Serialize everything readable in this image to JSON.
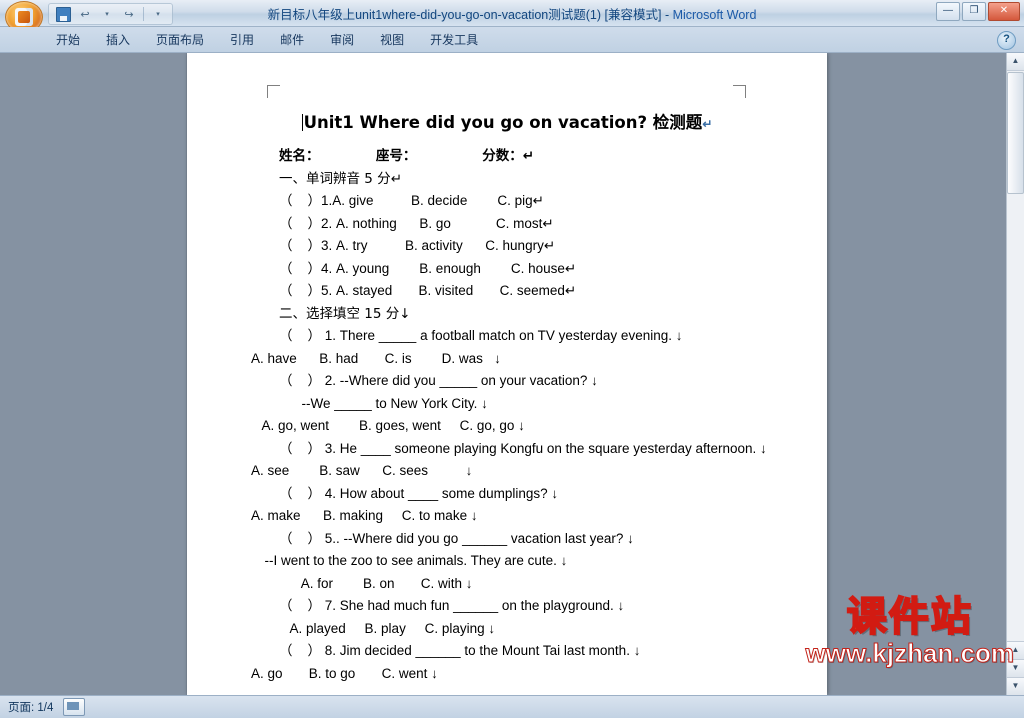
{
  "window": {
    "title_document": "新目标八年级上unit1where-did-you-go-on-vacation测试题(1) [兼容模式]",
    "title_separator": " - ",
    "app_name": "Microsoft Word",
    "minimize": "—",
    "maximize": "❐",
    "close": "✕"
  },
  "quick_access": {
    "save_tooltip": "保存",
    "undo": "↩",
    "undo_caret": "▾",
    "redo": "↪",
    "customize_caret": "▾"
  },
  "ribbon": {
    "tabs": [
      {
        "label": "开始",
        "active": false
      },
      {
        "label": "插入",
        "active": false
      },
      {
        "label": "页面布局",
        "active": false
      },
      {
        "label": "引用",
        "active": false
      },
      {
        "label": "邮件",
        "active": false
      },
      {
        "label": "审阅",
        "active": false
      },
      {
        "label": "视图",
        "active": false
      },
      {
        "label": "开发工具",
        "active": false
      }
    ],
    "help_label": "?"
  },
  "document": {
    "title": "Unit1 Where did you go on vacation?  检测题",
    "paragraph_mark": "↵",
    "lines": [
      "姓名：            座号：              分数：↵",
      "一、单词辨音 5 分↵",
      "（    ）1.A. give          B. decide        C. pig↵",
      "（    ）2. A. nothing      B. go            C. most↵",
      "（    ）3. A. try          B. activity      C. hungry↵",
      "（    ）4. A. young        B. enough        C. house↵",
      "（    ）5. A. stayed       B. visited       C. seemed↵",
      "二、选择填空 15 分↓",
      "（    ） 1. There _____ a football match on TV yesterday evening. ↓",
      "A. have      B. had       C. is        D. was   ↓",
      "（    ） 2. --Where did you _____ on your vacation? ↓",
      "      --We _____ to New York City. ↓",
      "   A. go, went        B. goes, went     C. go, go ↓",
      "（    ） 3. He ____ someone playing Kongfu on the square yesterday afternoon. ↓",
      "A. see        B. saw      C. sees          ↓",
      "（    ） 4. How about ____ some dumplings? ↓",
      "A. make      B. making     C. to make ↓",
      "（    ） 5.. --Where did you go ______ vacation last year? ↓",
      "  --I went to the zoo to see animals. They are cute. ↓",
      "      A. for        B. on       C. with ↓",
      "（    ） 7. She had much fun ______ on the playground. ↓",
      "   A. played     B. play     C. playing ↓",
      "（    ） 8. Jim decided ______ to the Mount Tai last month. ↓",
      "A. go       B. to go       C. went ↓"
    ]
  },
  "status_bar": {
    "page_label": "页面: 1/4"
  },
  "watermark": {
    "top": "课件站",
    "bottom": "www.kjzhan.com"
  },
  "scrollbar": {
    "up_arrow": "▲",
    "down_arrow": "▼",
    "prev_page": "▲",
    "next_page": "▼"
  },
  "colors": {
    "title_blue": "#12467f",
    "watermark_yellow": "#fdf32a",
    "watermark_red": "#d21b12",
    "page_white": "#ffffff",
    "desk_gray": "#8592a2"
  }
}
